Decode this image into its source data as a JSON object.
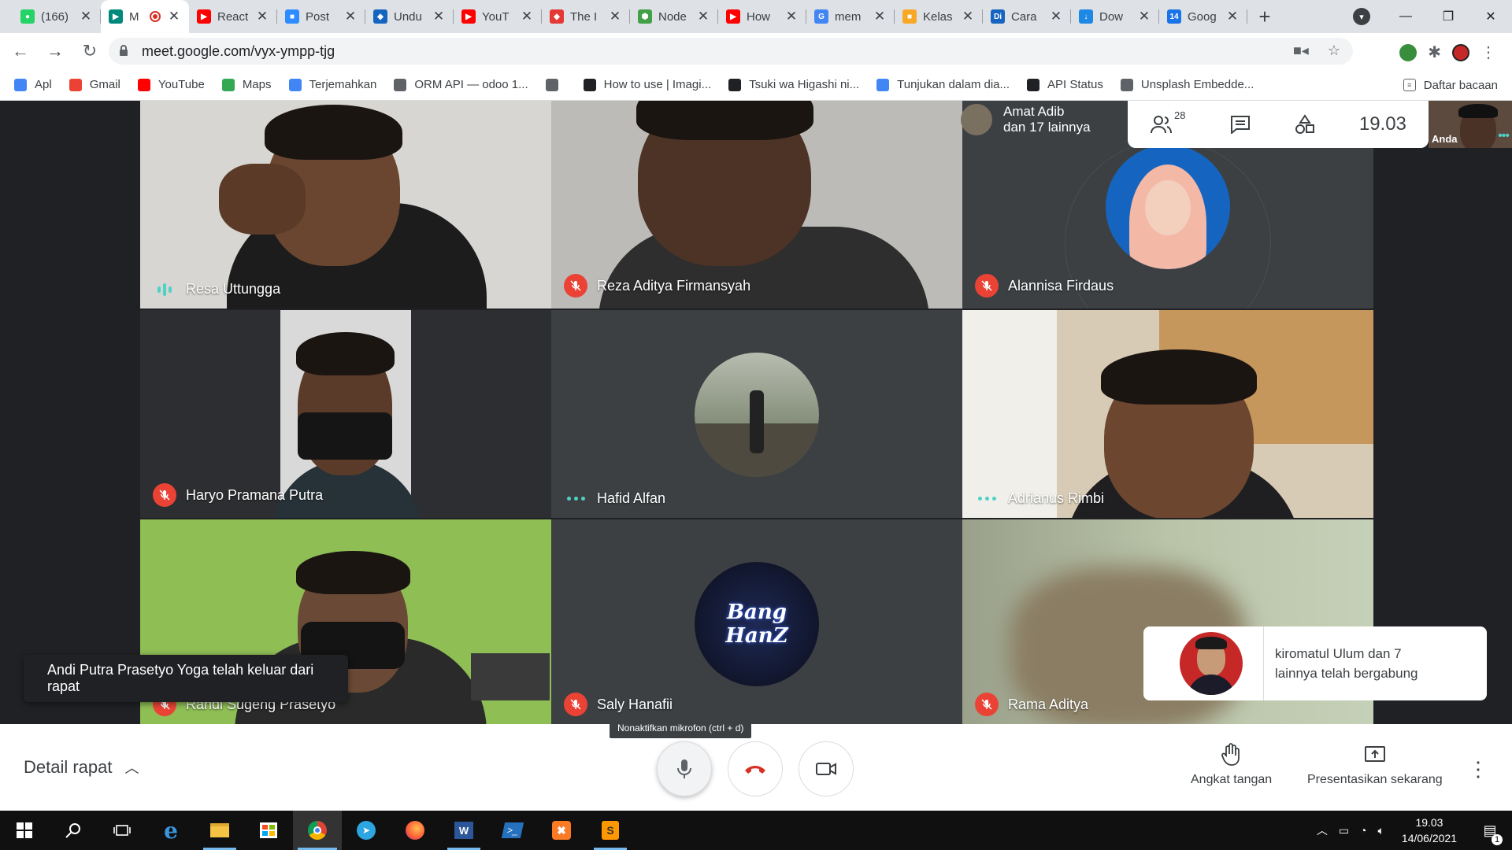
{
  "browser": {
    "tabs": [
      {
        "title": "(166)",
        "color": "#25d366",
        "glyph": "●"
      },
      {
        "title": "M",
        "color": "#00897b",
        "glyph": "▶",
        "active": true,
        "recording": true
      },
      {
        "title": "React",
        "color": "#ff0000",
        "glyph": "▶"
      },
      {
        "title": "Post",
        "color": "#2d8cff",
        "glyph": "■"
      },
      {
        "title": "Undu",
        "color": "#1565c0",
        "glyph": "◆"
      },
      {
        "title": "YouT",
        "color": "#ff0000",
        "glyph": "▶"
      },
      {
        "title": "The I",
        "color": "#e53935",
        "glyph": "◆"
      },
      {
        "title": "Node",
        "color": "#43a047",
        "glyph": "⬢"
      },
      {
        "title": "How",
        "color": "#ff0000",
        "glyph": "▶"
      },
      {
        "title": "mem",
        "color": "#4285f4",
        "glyph": "G"
      },
      {
        "title": "Kelas",
        "color": "#f9a825",
        "glyph": "■"
      },
      {
        "title": "Cara",
        "color": "#1565c0",
        "glyph": "Di"
      },
      {
        "title": "Dow",
        "color": "#1e88e5",
        "glyph": "↓"
      },
      {
        "title": "Goog",
        "color": "#1a73e8",
        "glyph": "14"
      }
    ],
    "url": "meet.google.com/vyx-ympp-tjg",
    "bookmarks": [
      {
        "label": "Apl",
        "color": "#4285f4"
      },
      {
        "label": "Gmail",
        "color": "#ea4335"
      },
      {
        "label": "YouTube",
        "color": "#ff0000"
      },
      {
        "label": "Maps",
        "color": "#34a853"
      },
      {
        "label": "Terjemahkan",
        "color": "#4285f4"
      },
      {
        "label": "ORM API — odoo 1...",
        "color": "#5f6368"
      },
      {
        "label": "",
        "color": "#5f6368"
      },
      {
        "label": "How to use | Imagi...",
        "color": "#202124"
      },
      {
        "label": "Tsuki wa Higashi ni...",
        "color": "#202124"
      },
      {
        "label": "Tunjukan dalam dia...",
        "color": "#4285f4"
      },
      {
        "label": "API Status",
        "color": "#202124"
      },
      {
        "label": "Unsplash Embedde...",
        "color": "#5f6368"
      }
    ],
    "reading_list": "Daftar bacaan"
  },
  "meet": {
    "participants": [
      {
        "name": "Resa Uttungga",
        "status": "speaking"
      },
      {
        "name": "Reza Aditya Firmansyah",
        "status": "muted"
      },
      {
        "name": "Alannisa Firdaus",
        "status": "muted"
      },
      {
        "name": "Haryo Pramana Putra",
        "status": "muted"
      },
      {
        "name": "Hafid Alfan",
        "status": "dots"
      },
      {
        "name": "Adrianus Rimbi",
        "status": "dots"
      },
      {
        "name": "Randi Sugeng Prasetyo",
        "status": "muted"
      },
      {
        "name": "Saly Hanafii",
        "status": "muted"
      },
      {
        "name": "Rama Aditya",
        "status": "muted"
      }
    ],
    "presenter": {
      "line1": "Amat Adib",
      "line2": "dan 17 lainnya"
    },
    "people_count": "28",
    "time": "19.03",
    "self_label": "Anda",
    "avatar_text": "Bang HanZ",
    "toast_left": "Andi Putra Prasetyo Yoga telah keluar dari rapat",
    "toast_right": "kiromatul Ulum dan 7 lainnya telah bergabung",
    "tooltip": "Nonaktifkan mikrofon (ctrl + d)",
    "details_label": "Detail rapat",
    "raise_hand": "Angkat tangan",
    "present_now": "Presentasikan sekarang"
  },
  "taskbar": {
    "time": "19.03",
    "date": "14/06/2021",
    "notifications": "1"
  }
}
